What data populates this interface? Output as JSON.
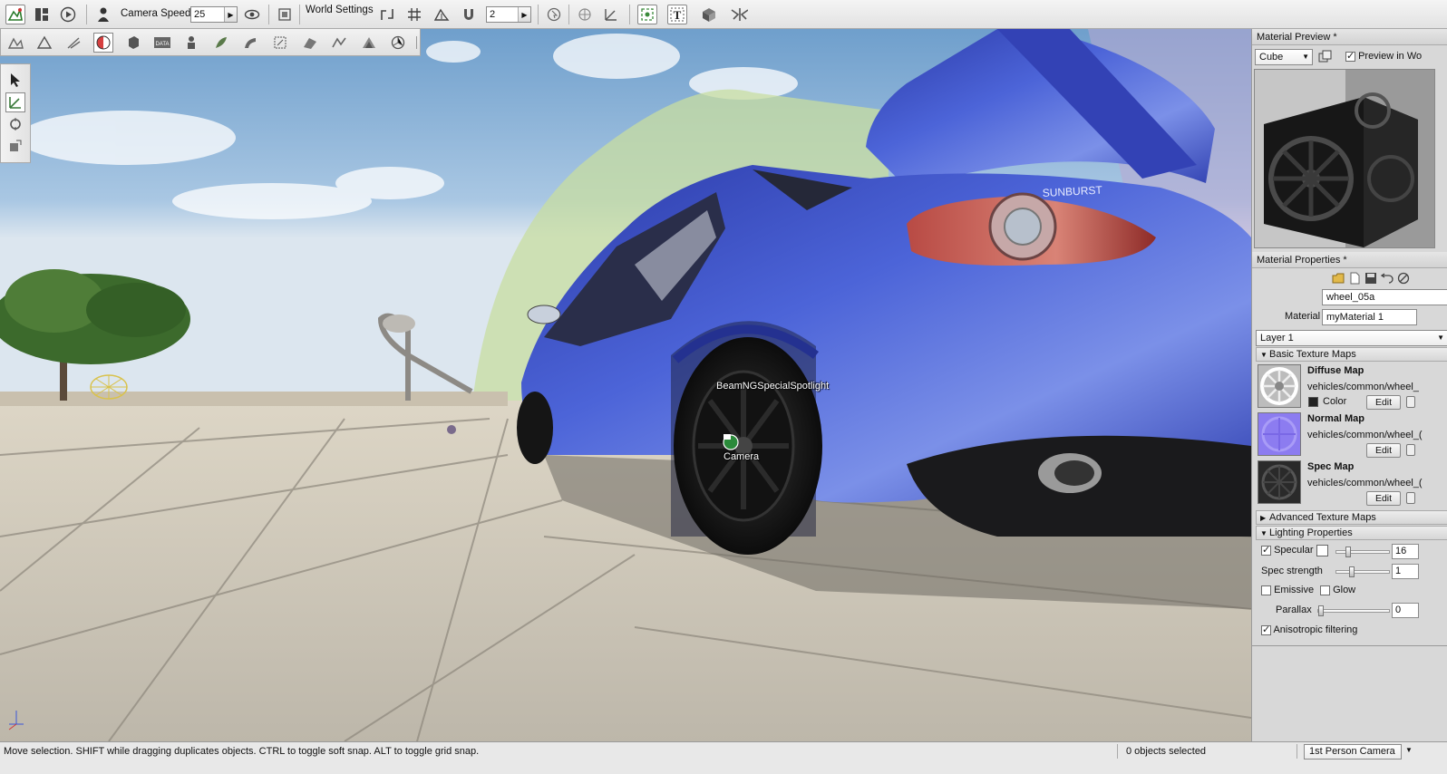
{
  "toolbar": {
    "camera_speed_label": "Camera Speed",
    "camera_speed_value": "25",
    "world_settings_label": "World Settings",
    "grid_value": "2"
  },
  "viewport": {
    "labels": {
      "spotlight": "BeamNGSpecialSpotlight",
      "camera": "Camera"
    },
    "car_badge": "SUNBURST"
  },
  "material_preview": {
    "title": "Material Preview *",
    "shape_select": "Cube",
    "preview_in_world_label": "Preview in Wo",
    "preview_in_world_checked": true
  },
  "material_properties": {
    "title": "Material Properties *",
    "name_value": "wheel_05a",
    "material_label": "Material",
    "material_value": "myMaterial 1",
    "layer_select": "Layer 1",
    "basic_texture_maps": {
      "header": "Basic Texture Maps",
      "maps": [
        {
          "name": "Diffuse Map",
          "path": "vehicles/common/wheel_",
          "color_label": "Color",
          "edit_label": "Edit"
        },
        {
          "name": "Normal Map",
          "path": "vehicles/common/wheel_(",
          "edit_label": "Edit"
        },
        {
          "name": "Spec Map",
          "path": "vehicles/common/wheel_(",
          "edit_label": "Edit"
        }
      ]
    },
    "advanced_texture_maps_header": "Advanced Texture Maps",
    "lighting": {
      "header": "Lighting Properties",
      "specular_label": "Specular",
      "specular_checked": true,
      "specular_value": "16",
      "spec_strength_label": "Spec strength",
      "spec_strength_value": "1",
      "emissive_label": "Emissive",
      "emissive_checked": false,
      "glow_label": "Glow",
      "glow_checked": false,
      "parallax_label": "Parallax",
      "parallax_value": "0",
      "anisotropic_label": "Anisotropic filtering",
      "anisotropic_checked": true
    }
  },
  "statusbar": {
    "hint": "Move selection.  SHIFT while dragging duplicates objects.  CTRL to toggle soft snap.  ALT to toggle grid snap.",
    "selection": "0 objects selected",
    "camera_mode": "1st Person Camera"
  },
  "colors": {
    "car_body": "#3a4fc4",
    "sky_top": "#7ea7cf",
    "ground": "#c9c3b6",
    "diffuse_thumb": "#bcbcbc",
    "normal_thumb": "#8c7cf0",
    "spec_thumb": "#2a2a2a"
  }
}
